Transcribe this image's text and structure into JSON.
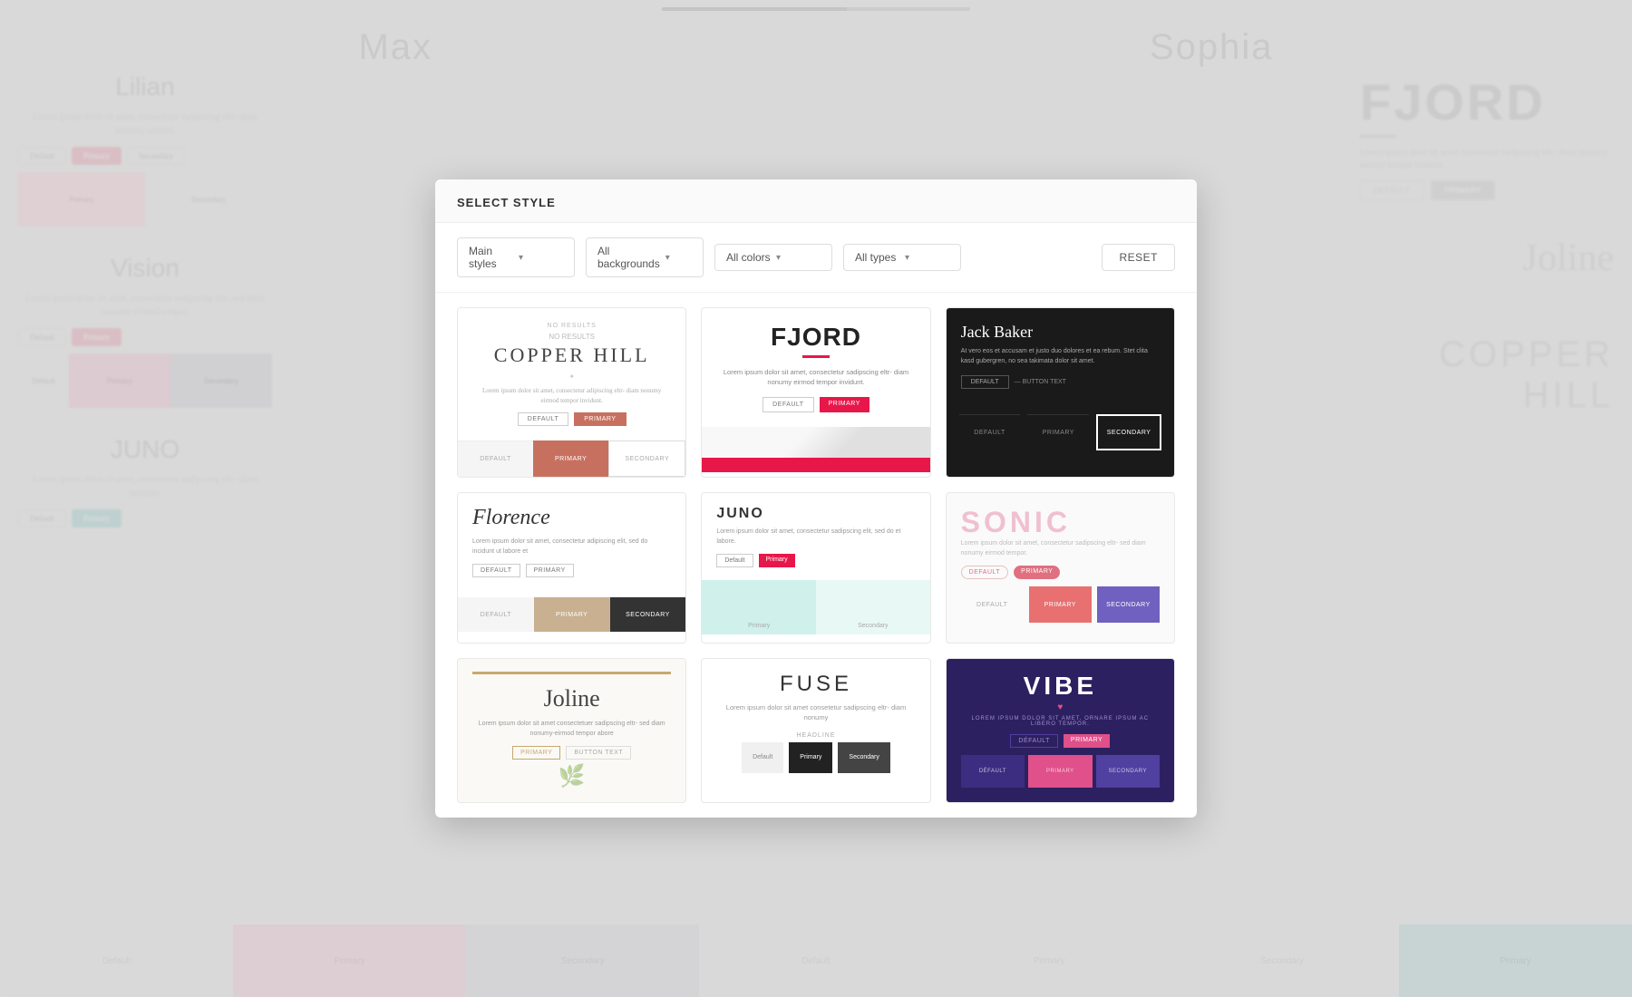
{
  "page": {
    "title": "Select Style",
    "backgrounds_label": "backgrounds",
    "progress_fill_percent": 60
  },
  "filters": {
    "style_label": "Main styles",
    "background_label": "All backgrounds",
    "color_label": "All colors",
    "type_label": "All types",
    "reset_label": "RESET"
  },
  "modal": {
    "title": "SELECT STYLE"
  },
  "cards": [
    {
      "id": "copper-hill",
      "name": "Copper Hill",
      "subtitle": "NO RESULTS",
      "text": "Lorem ipsum dolor sit amet, consectetur adipiscing eltr- diam nonumy eirmod tempor invidunt.",
      "buttons": [
        "DEFAULT",
        "PRIMARY"
      ],
      "swatches": [
        {
          "label": "DEFAULT",
          "color": "#f0f0f0",
          "text_color": "#aaa"
        },
        {
          "label": "PRIMARY",
          "color": "#c87060",
          "text_color": "#fff"
        },
        {
          "label": "SECONDARY",
          "color": "#f0f0f0",
          "text_color": "#aaa",
          "border": true
        }
      ]
    },
    {
      "id": "fjord",
      "name": "FJORD",
      "text": "Lorem ipsum dolor sit amet, consectetur sadipscing eltr- diam nonumy eirmod tempor invidunt.",
      "buttons": [
        "DEFAULT",
        "PRIMARY"
      ],
      "accent": "#e8174a"
    },
    {
      "id": "jack-baker",
      "name": "Jack Baker",
      "text": "At vero eos et accusam et justo duo dolores et ea rebum. Stet clita kasd gubergren, no sea takimata dolor sit amet.",
      "buttons": [
        "DEFAULT",
        "BUTTON TEXT"
      ],
      "swatches": [
        {
          "label": "Default",
          "color": "transparent",
          "text_color": "#aaa"
        },
        {
          "label": "Primary",
          "color": "transparent",
          "text_color": "#aaa"
        },
        {
          "label": "Secondary",
          "color": "#1a1a1a",
          "text_color": "#fff"
        }
      ],
      "dark": true
    },
    {
      "id": "florence",
      "name": "Florence",
      "text": "Lorem ipsum dolor sit amet, consectetur adipiscing elit, sed do incidunt ut labore et",
      "buttons": [
        "DEFAULT",
        "PRIMARY"
      ],
      "swatches": [
        {
          "label": "Default",
          "color": "#f8f8f8",
          "text_color": "#999"
        },
        {
          "label": "Primary",
          "color": "#c8b090",
          "text_color": "#fff"
        },
        {
          "label": "Secondary",
          "color": "#333",
          "text_color": "#fff"
        }
      ]
    },
    {
      "id": "juno",
      "name": "JUNO",
      "text": "Lorem ipsum dolor sit amet, consectetur sadipscing elit, sed do et labore.",
      "buttons": [
        "Default",
        "Primary"
      ],
      "swatches": [
        {
          "label": "Primary",
          "color": "#d0f0ec",
          "text_color": "#aaa"
        },
        {
          "label": "Secondary",
          "color": "#e8f8f5",
          "text_color": "#aaa"
        }
      ]
    },
    {
      "id": "sonic",
      "name": "SONIC",
      "text": "Lorem ipsum dolor sit amet, consectetur sadipscing eltr- sed diam nonumy eirmod tempor.",
      "buttons": [
        "Default",
        "Primary"
      ],
      "swatches": [
        {
          "label": "DEFAULT",
          "color": "transparent",
          "text_color": "#aaa"
        },
        {
          "label": "PRIMARY",
          "color": "#e87070",
          "text_color": "#fff"
        },
        {
          "label": "SECONDARY",
          "color": "#7060c0",
          "text_color": "#fff"
        }
      ]
    },
    {
      "id": "joline",
      "name": "Joline",
      "text": "Lorem ipsum dolor sit amet consectetuer sadipscing eltr- sed diam nonumy-eirmod tempor abore",
      "buttons": [
        "PRIMARY",
        "BUTTON TEXT"
      ],
      "accent": "#c8a870"
    },
    {
      "id": "fuse",
      "name": "FUSE",
      "text": "Lorem ipsum dolor sit amet consetetur sadipscing eltr- diam nonumy",
      "headline": "HEADLINE",
      "swatches": [
        {
          "label": "Default",
          "color": "#f0f0f0",
          "text_color": "#888"
        },
        {
          "label": "Primary",
          "color": "#222",
          "text_color": "#fff"
        },
        {
          "label": "Secondary",
          "color": "#444",
          "text_color": "#fff"
        }
      ]
    },
    {
      "id": "vibe",
      "name": "VIBE",
      "subtitle": "LOREM IPSUM DOLOR SIT AMET, ORNARE IPSUM AC LIBERO TEMPOR.",
      "text": "",
      "buttons": [
        "DÉFAULT",
        "PRIMARY"
      ],
      "swatches": [
        {
          "label": "DÉFAULT",
          "color": "#3d2d80",
          "text_color": "rgba(255,255,255,0.7)"
        },
        {
          "label": "PRIMARY",
          "color": "#e0508a",
          "text_color": "#fff"
        },
        {
          "label": "SECONDARY",
          "color": "#5040a0",
          "text_color": "#fff"
        }
      ],
      "dark": true
    }
  ],
  "bg": {
    "left_cards": [
      {
        "title": "Lilian",
        "text": "Lorem ipsum dolor sit amet, consectetur sadipscing eltr- diam nonumy eirmod.",
        "swatches": [
          {
            "color": "#f8d0d8",
            "label": "Primary"
          },
          {
            "color": "#e8e8e8",
            "label": "Secondary"
          }
        ]
      },
      {
        "title": "Vision",
        "text": "Lorem ipsum dolor sit amet, consectetur sadipscing eltr- sed diam nonumy eirmod tempor.",
        "swatches": [
          {
            "color": "#f0c0d0",
            "label": "Primary"
          },
          {
            "color": "#d0d0d8",
            "label": "Secondary"
          }
        ]
      },
      {
        "title": "JUNO",
        "text": "Lorem ipsum dolor sit amet, consectetur sadipscing eltr- diam nonumy.",
        "swatches": [
          {
            "color": "#e0f0f0",
            "label": "Default"
          },
          {
            "color": "#a0d8e0",
            "label": "Primary"
          }
        ]
      }
    ],
    "right_title": "FJORD",
    "right_text": "Lorem ipsum dolor sit amet consetetur sadipscing eltr- diam nonumy eirmod tempor invidunt.",
    "right_buttons": [
      "DEFAULT",
      "PRIMARY"
    ],
    "right_title2": "Joline",
    "right_title3": "COPPER HILL",
    "top_names": [
      "Max",
      "Sophia"
    ]
  },
  "bottom_bg": [
    {
      "title": "Primary",
      "swatches": [
        {
          "color": "#f8c0d0",
          "label": ""
        },
        {
          "color": "#e0b8c8",
          "label": ""
        }
      ]
    }
  ]
}
